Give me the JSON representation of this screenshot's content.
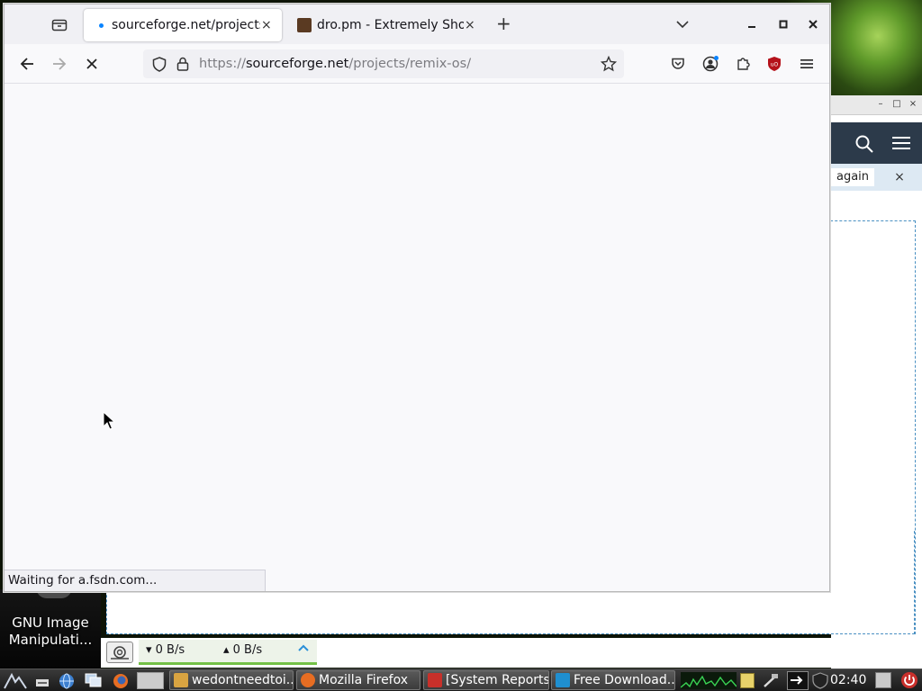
{
  "desktop": {
    "icon_label": "GNU Image Manipulati..."
  },
  "background_window": {
    "notice_text": "again",
    "notice_close": "×",
    "title_controls": [
      "–",
      "□",
      "×"
    ]
  },
  "download_bar": {
    "down_speed": "▾ 0 B/s",
    "up_speed": "▴ 0 B/s",
    "expand_icon": "chevron-up-icon"
  },
  "browser": {
    "tabs": [
      {
        "title": "sourceforge.net/projects/remix-os/",
        "active": true,
        "close": "×"
      },
      {
        "title": "dro.pm - Extremely Short URLs",
        "active": false,
        "close": "×"
      }
    ],
    "new_tab": "+",
    "url": {
      "scheme": "https://",
      "host": "sourceforge.net",
      "path": "/projects/remix-os/"
    },
    "status_text": "Waiting for a.fsdn.com...",
    "colors": {
      "ublock_red": "#b5121b",
      "accent": "#0a84ff"
    }
  },
  "taskbar": {
    "tasks": [
      {
        "label": "wedontneedtoi...",
        "icon": "file-manager-icon"
      },
      {
        "label": "Mozilla Firefox",
        "icon": "firefox-icon"
      },
      {
        "label": "[System Reports]",
        "icon": "warning-icon"
      },
      {
        "label": "Free Download...",
        "icon": "download-icon"
      }
    ],
    "clock": "02:40"
  }
}
